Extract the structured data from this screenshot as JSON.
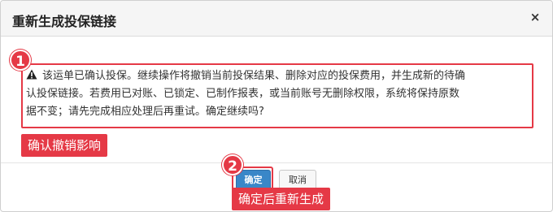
{
  "dialog": {
    "title": "重新生成投保链接",
    "close_glyph": "×",
    "message_lines": [
      "该运单已确认投保。继续操作将撤销当前投保结果、删除对应的投保费用，并生成新的待确",
      "认投保链接。若费用已对账、已锁定、已制作报表，或当前账号无删除权限，系统将保持原数",
      "据不变；请先完成相应处理后再重试。确定继续吗?"
    ],
    "warning_icon": "warning-triangle-icon",
    "buttons": {
      "confirm_label": "确定",
      "cancel_label": "取消"
    }
  },
  "annotations": {
    "marker_1": "1",
    "marker_2": "2",
    "callout_1": "确认撤销影响",
    "callout_2": "确定后重新生成"
  },
  "colors": {
    "annotation_red": "#e53946",
    "primary_button": "#3a87c8"
  }
}
